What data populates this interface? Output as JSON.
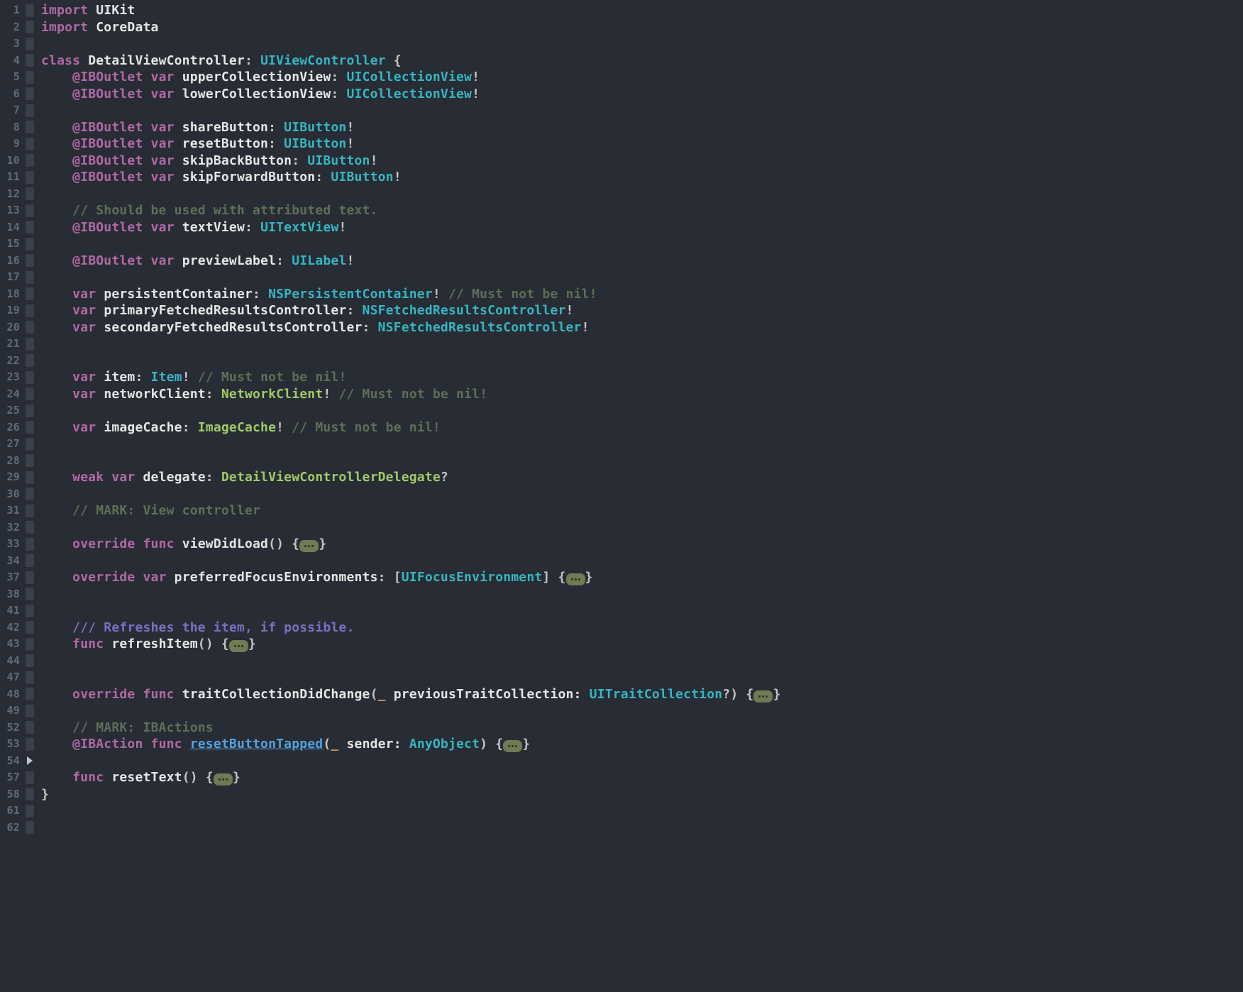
{
  "line_numbers": [
    "1",
    "2",
    "3",
    "4",
    "5",
    "6",
    "7",
    "8",
    "9",
    "10",
    "11",
    "12",
    "13",
    "14",
    "15",
    "16",
    "17",
    "18",
    "19",
    "20",
    "21",
    "22",
    "23",
    "24",
    "25",
    "26",
    "27",
    "28",
    "29",
    "30",
    "31",
    "32",
    "33",
    "34",
    "37",
    "38",
    "41",
    "42",
    "43",
    "44",
    "47",
    "48",
    "49",
    "52",
    "53",
    "54",
    "57",
    "58",
    "61",
    "62"
  ],
  "cursor_line_index": 45,
  "lines": [
    {
      "tokens": [
        {
          "t": "import ",
          "c": "kw"
        },
        {
          "t": "UIKit",
          "c": "id"
        }
      ]
    },
    {
      "tokens": [
        {
          "t": "import ",
          "c": "kw"
        },
        {
          "t": "CoreData",
          "c": "id"
        }
      ]
    },
    {
      "tokens": []
    },
    {
      "tokens": [
        {
          "t": "class ",
          "c": "kw"
        },
        {
          "t": "DetailViewController",
          "c": "id"
        },
        {
          "t": ": ",
          "c": "pn"
        },
        {
          "t": "UIViewController",
          "c": "type"
        },
        {
          "t": " {",
          "c": "pn"
        }
      ]
    },
    {
      "tokens": [
        {
          "t": "    ",
          "c": "pn"
        },
        {
          "t": "@IBOutlet ",
          "c": "attr"
        },
        {
          "t": "var ",
          "c": "kw"
        },
        {
          "t": "upperCollectionView",
          "c": "id"
        },
        {
          "t": ": ",
          "c": "pn"
        },
        {
          "t": "UICollectionView",
          "c": "type"
        },
        {
          "t": "!",
          "c": "pn"
        }
      ]
    },
    {
      "tokens": [
        {
          "t": "    ",
          "c": "pn"
        },
        {
          "t": "@IBOutlet ",
          "c": "attr"
        },
        {
          "t": "var ",
          "c": "kw"
        },
        {
          "t": "lowerCollectionView",
          "c": "id"
        },
        {
          "t": ": ",
          "c": "pn"
        },
        {
          "t": "UICollectionView",
          "c": "type"
        },
        {
          "t": "!",
          "c": "pn"
        }
      ]
    },
    {
      "tokens": []
    },
    {
      "tokens": [
        {
          "t": "    ",
          "c": "pn"
        },
        {
          "t": "@IBOutlet ",
          "c": "attr"
        },
        {
          "t": "var ",
          "c": "kw"
        },
        {
          "t": "shareButton",
          "c": "id"
        },
        {
          "t": ": ",
          "c": "pn"
        },
        {
          "t": "UIButton",
          "c": "type"
        },
        {
          "t": "!",
          "c": "pn"
        }
      ]
    },
    {
      "tokens": [
        {
          "t": "    ",
          "c": "pn"
        },
        {
          "t": "@IBOutlet ",
          "c": "attr"
        },
        {
          "t": "var ",
          "c": "kw"
        },
        {
          "t": "resetButton",
          "c": "id"
        },
        {
          "t": ": ",
          "c": "pn"
        },
        {
          "t": "UIButton",
          "c": "type"
        },
        {
          "t": "!",
          "c": "pn"
        }
      ]
    },
    {
      "tokens": [
        {
          "t": "    ",
          "c": "pn"
        },
        {
          "t": "@IBOutlet ",
          "c": "attr"
        },
        {
          "t": "var ",
          "c": "kw"
        },
        {
          "t": "skipBackButton",
          "c": "id"
        },
        {
          "t": ": ",
          "c": "pn"
        },
        {
          "t": "UIButton",
          "c": "type"
        },
        {
          "t": "!",
          "c": "pn"
        }
      ]
    },
    {
      "tokens": [
        {
          "t": "    ",
          "c": "pn"
        },
        {
          "t": "@IBOutlet ",
          "c": "attr"
        },
        {
          "t": "var ",
          "c": "kw"
        },
        {
          "t": "skipForwardButton",
          "c": "id"
        },
        {
          "t": ": ",
          "c": "pn"
        },
        {
          "t": "UIButton",
          "c": "type"
        },
        {
          "t": "!",
          "c": "pn"
        }
      ]
    },
    {
      "tokens": []
    },
    {
      "tokens": [
        {
          "t": "    ",
          "c": "pn"
        },
        {
          "t": "// Should be used with attributed text.",
          "c": "cm"
        }
      ]
    },
    {
      "tokens": [
        {
          "t": "    ",
          "c": "pn"
        },
        {
          "t": "@IBOutlet ",
          "c": "attr"
        },
        {
          "t": "var ",
          "c": "kw"
        },
        {
          "t": "textView",
          "c": "id"
        },
        {
          "t": ": ",
          "c": "pn"
        },
        {
          "t": "UITextView",
          "c": "type"
        },
        {
          "t": "!",
          "c": "pn"
        }
      ]
    },
    {
      "tokens": []
    },
    {
      "tokens": [
        {
          "t": "    ",
          "c": "pn"
        },
        {
          "t": "@IBOutlet ",
          "c": "attr"
        },
        {
          "t": "var ",
          "c": "kw"
        },
        {
          "t": "previewLabel",
          "c": "id"
        },
        {
          "t": ": ",
          "c": "pn"
        },
        {
          "t": "UILabel",
          "c": "type"
        },
        {
          "t": "!",
          "c": "pn"
        }
      ]
    },
    {
      "tokens": []
    },
    {
      "tokens": [
        {
          "t": "    ",
          "c": "pn"
        },
        {
          "t": "var ",
          "c": "kw"
        },
        {
          "t": "persistentContainer",
          "c": "id"
        },
        {
          "t": ": ",
          "c": "pn"
        },
        {
          "t": "NSPersistentContainer",
          "c": "type"
        },
        {
          "t": "!",
          "c": "pn"
        },
        {
          "t": " // Must not be nil!",
          "c": "cm"
        }
      ]
    },
    {
      "tokens": [
        {
          "t": "    ",
          "c": "pn"
        },
        {
          "t": "var ",
          "c": "kw"
        },
        {
          "t": "primaryFetchedResultsController",
          "c": "id"
        },
        {
          "t": ": ",
          "c": "pn"
        },
        {
          "t": "NSFetchedResultsController",
          "c": "type"
        },
        {
          "t": "!",
          "c": "pn"
        }
      ]
    },
    {
      "tokens": [
        {
          "t": "    ",
          "c": "pn"
        },
        {
          "t": "var ",
          "c": "kw"
        },
        {
          "t": "secondaryFetchedResultsController",
          "c": "id"
        },
        {
          "t": ": ",
          "c": "pn"
        },
        {
          "t": "NSFetchedResultsController",
          "c": "type"
        },
        {
          "t": "!",
          "c": "pn"
        }
      ]
    },
    {
      "tokens": []
    },
    {
      "tokens": []
    },
    {
      "tokens": [
        {
          "t": "    ",
          "c": "pn"
        },
        {
          "t": "var ",
          "c": "kw"
        },
        {
          "t": "item",
          "c": "id"
        },
        {
          "t": ": ",
          "c": "pn"
        },
        {
          "t": "Item",
          "c": "type"
        },
        {
          "t": "!",
          "c": "pn"
        },
        {
          "t": " // Must not be nil!",
          "c": "cm"
        }
      ]
    },
    {
      "tokens": [
        {
          "t": "    ",
          "c": "pn"
        },
        {
          "t": "var ",
          "c": "kw"
        },
        {
          "t": "networkClient",
          "c": "id"
        },
        {
          "t": ": ",
          "c": "pn"
        },
        {
          "t": "NetworkClient",
          "c": "usr"
        },
        {
          "t": "!",
          "c": "pn"
        },
        {
          "t": " // Must not be nil!",
          "c": "cm"
        }
      ]
    },
    {
      "tokens": []
    },
    {
      "tokens": [
        {
          "t": "    ",
          "c": "pn"
        },
        {
          "t": "var ",
          "c": "kw"
        },
        {
          "t": "imageCache",
          "c": "id"
        },
        {
          "t": ": ",
          "c": "pn"
        },
        {
          "t": "ImageCache",
          "c": "usr"
        },
        {
          "t": "!",
          "c": "pn"
        },
        {
          "t": " // Must not be nil!",
          "c": "cm"
        }
      ]
    },
    {
      "tokens": []
    },
    {
      "tokens": []
    },
    {
      "tokens": [
        {
          "t": "    ",
          "c": "pn"
        },
        {
          "t": "weak ",
          "c": "kw"
        },
        {
          "t": "var ",
          "c": "kw"
        },
        {
          "t": "delegate",
          "c": "id"
        },
        {
          "t": ": ",
          "c": "pn"
        },
        {
          "t": "DetailViewControllerDelegate",
          "c": "usr"
        },
        {
          "t": "?",
          "c": "pn"
        }
      ]
    },
    {
      "tokens": []
    },
    {
      "tokens": [
        {
          "t": "    ",
          "c": "pn"
        },
        {
          "t": "// MARK: View controller",
          "c": "cm"
        }
      ]
    },
    {
      "tokens": []
    },
    {
      "tokens": [
        {
          "t": "    ",
          "c": "pn"
        },
        {
          "t": "override ",
          "c": "kw"
        },
        {
          "t": "func ",
          "c": "kw"
        },
        {
          "t": "viewDidLoad",
          "c": "fn"
        },
        {
          "t": "() {",
          "c": "pn"
        },
        {
          "fold": true
        },
        {
          "t": "}",
          "c": "pn"
        }
      ]
    },
    {
      "tokens": []
    },
    {
      "tokens": [
        {
          "t": "    ",
          "c": "pn"
        },
        {
          "t": "override ",
          "c": "kw"
        },
        {
          "t": "var ",
          "c": "kw"
        },
        {
          "t": "preferredFocusEnvironments",
          "c": "id"
        },
        {
          "t": ": [",
          "c": "pn"
        },
        {
          "t": "UIFocusEnvironment",
          "c": "type"
        },
        {
          "t": "] {",
          "c": "pn"
        },
        {
          "fold": true
        },
        {
          "t": "}",
          "c": "pn"
        }
      ]
    },
    {
      "tokens": []
    },
    {
      "tokens": []
    },
    {
      "tokens": [
        {
          "t": "    ",
          "c": "pn"
        },
        {
          "t": "/// Refreshes the item, if possible.",
          "c": "doc"
        }
      ]
    },
    {
      "tokens": [
        {
          "t": "    ",
          "c": "pn"
        },
        {
          "t": "func ",
          "c": "kw"
        },
        {
          "t": "refreshItem",
          "c": "fn"
        },
        {
          "t": "() {",
          "c": "pn"
        },
        {
          "fold": true
        },
        {
          "t": "}",
          "c": "pn"
        }
      ]
    },
    {
      "tokens": []
    },
    {
      "tokens": []
    },
    {
      "tokens": [
        {
          "t": "    ",
          "c": "pn"
        },
        {
          "t": "override ",
          "c": "kw"
        },
        {
          "t": "func ",
          "c": "kw"
        },
        {
          "t": "traitCollectionDidChange",
          "c": "fn"
        },
        {
          "t": "(",
          "c": "pn"
        },
        {
          "t": "_",
          "c": "pl"
        },
        {
          "t": " previousTraitCollection: ",
          "c": "id"
        },
        {
          "t": "UITraitCollection",
          "c": "type"
        },
        {
          "t": "?) {",
          "c": "pn"
        },
        {
          "fold": true
        },
        {
          "t": "}",
          "c": "pn"
        }
      ]
    },
    {
      "tokens": []
    },
    {
      "tokens": [
        {
          "t": "    ",
          "c": "pn"
        },
        {
          "t": "// MARK: IBActions",
          "c": "cm"
        }
      ]
    },
    {
      "tokens": [
        {
          "t": "    ",
          "c": "pn"
        },
        {
          "t": "@IBAction ",
          "c": "attr"
        },
        {
          "t": "func ",
          "c": "kw"
        },
        {
          "t": "resetButtonTapped",
          "c": "link"
        },
        {
          "t": "(",
          "c": "pn"
        },
        {
          "t": "_",
          "c": "pl"
        },
        {
          "t": " sender: ",
          "c": "id"
        },
        {
          "t": "AnyObject",
          "c": "type"
        },
        {
          "t": ") {",
          "c": "pn"
        },
        {
          "fold": true
        },
        {
          "t": "}",
          "c": "pn"
        }
      ]
    },
    {
      "tokens": []
    },
    {
      "tokens": [
        {
          "t": "    ",
          "c": "pn"
        },
        {
          "t": "func ",
          "c": "kw"
        },
        {
          "t": "resetText",
          "c": "fn"
        },
        {
          "t": "() {",
          "c": "pn"
        },
        {
          "fold": true
        },
        {
          "t": "}",
          "c": "pn"
        }
      ]
    },
    {
      "tokens": [
        {
          "t": "}",
          "c": "pn"
        }
      ]
    },
    {
      "tokens": []
    }
  ]
}
